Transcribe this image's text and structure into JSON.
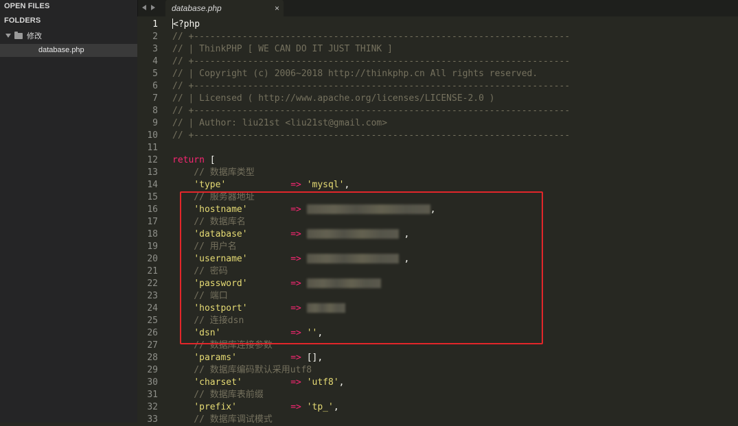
{
  "sidebar": {
    "open_files_label": "OPEN FILES",
    "folders_label": "FOLDERS",
    "folder_name": "修改",
    "file_name": "database.php"
  },
  "tabs": [
    {
      "label": "database.php",
      "close": "×"
    }
  ],
  "editor": {
    "line_numbers": [
      "1",
      "2",
      "3",
      "4",
      "5",
      "6",
      "7",
      "8",
      "9",
      "10",
      "11",
      "12",
      "13",
      "14",
      "15",
      "16",
      "17",
      "18",
      "19",
      "20",
      "21",
      "22",
      "23",
      "24",
      "25",
      "26",
      "27",
      "28",
      "29",
      "30",
      "31",
      "32",
      "33"
    ],
    "lines": {
      "l1": "<?php",
      "l2": "// +----------------------------------------------------------------------",
      "l3": "// | ThinkPHP [ WE CAN DO IT JUST THINK ]",
      "l4": "// +----------------------------------------------------------------------",
      "l5": "// | Copyright (c) 2006~2018 http://thinkphp.cn All rights reserved.",
      "l6": "// +----------------------------------------------------------------------",
      "l7": "// | Licensed ( http://www.apache.org/licenses/LICENSE-2.0 )",
      "l8": "// +----------------------------------------------------------------------",
      "l9": "// | Author: liu21st <liu21st@gmail.com>",
      "l10": "// +----------------------------------------------------------------------",
      "l12_kw": "return",
      "l12_rest": " [",
      "l13": "    // 数据库类型",
      "l14_key": "'type'",
      "l14_val": "'mysql'",
      "l15": "    // 服务器地址",
      "l16_key": "'hostname'",
      "l17": "    // 数据库名",
      "l18_key": "'database'",
      "l19": "    // 用户名",
      "l20_key": "'username'",
      "l21": "    // 密码",
      "l22_key": "'password'",
      "l23": "    // 端口",
      "l24_key": "'hostport'",
      "l25": "    // 连接dsn",
      "l26_key": "'dsn'",
      "l26_val": "''",
      "l27": "    // 数据库连接参数",
      "l28_key": "'params'",
      "l28_val": "[]",
      "l29": "    // 数据库编码默认采用utf8",
      "l30_key": "'charset'",
      "l30_val": "'utf8'",
      "l31": "    // 数据库表前缀",
      "l32_key": "'prefix'",
      "l32_val": "'tp_'",
      "l33": "    // 数据库调试模式",
      "arrow": "=>",
      "comma": ","
    }
  },
  "colors": {
    "background": "#272822",
    "comment": "#75715e",
    "string": "#e6db74",
    "keyword": "#f92672",
    "highlight_box": "#e3262a"
  }
}
